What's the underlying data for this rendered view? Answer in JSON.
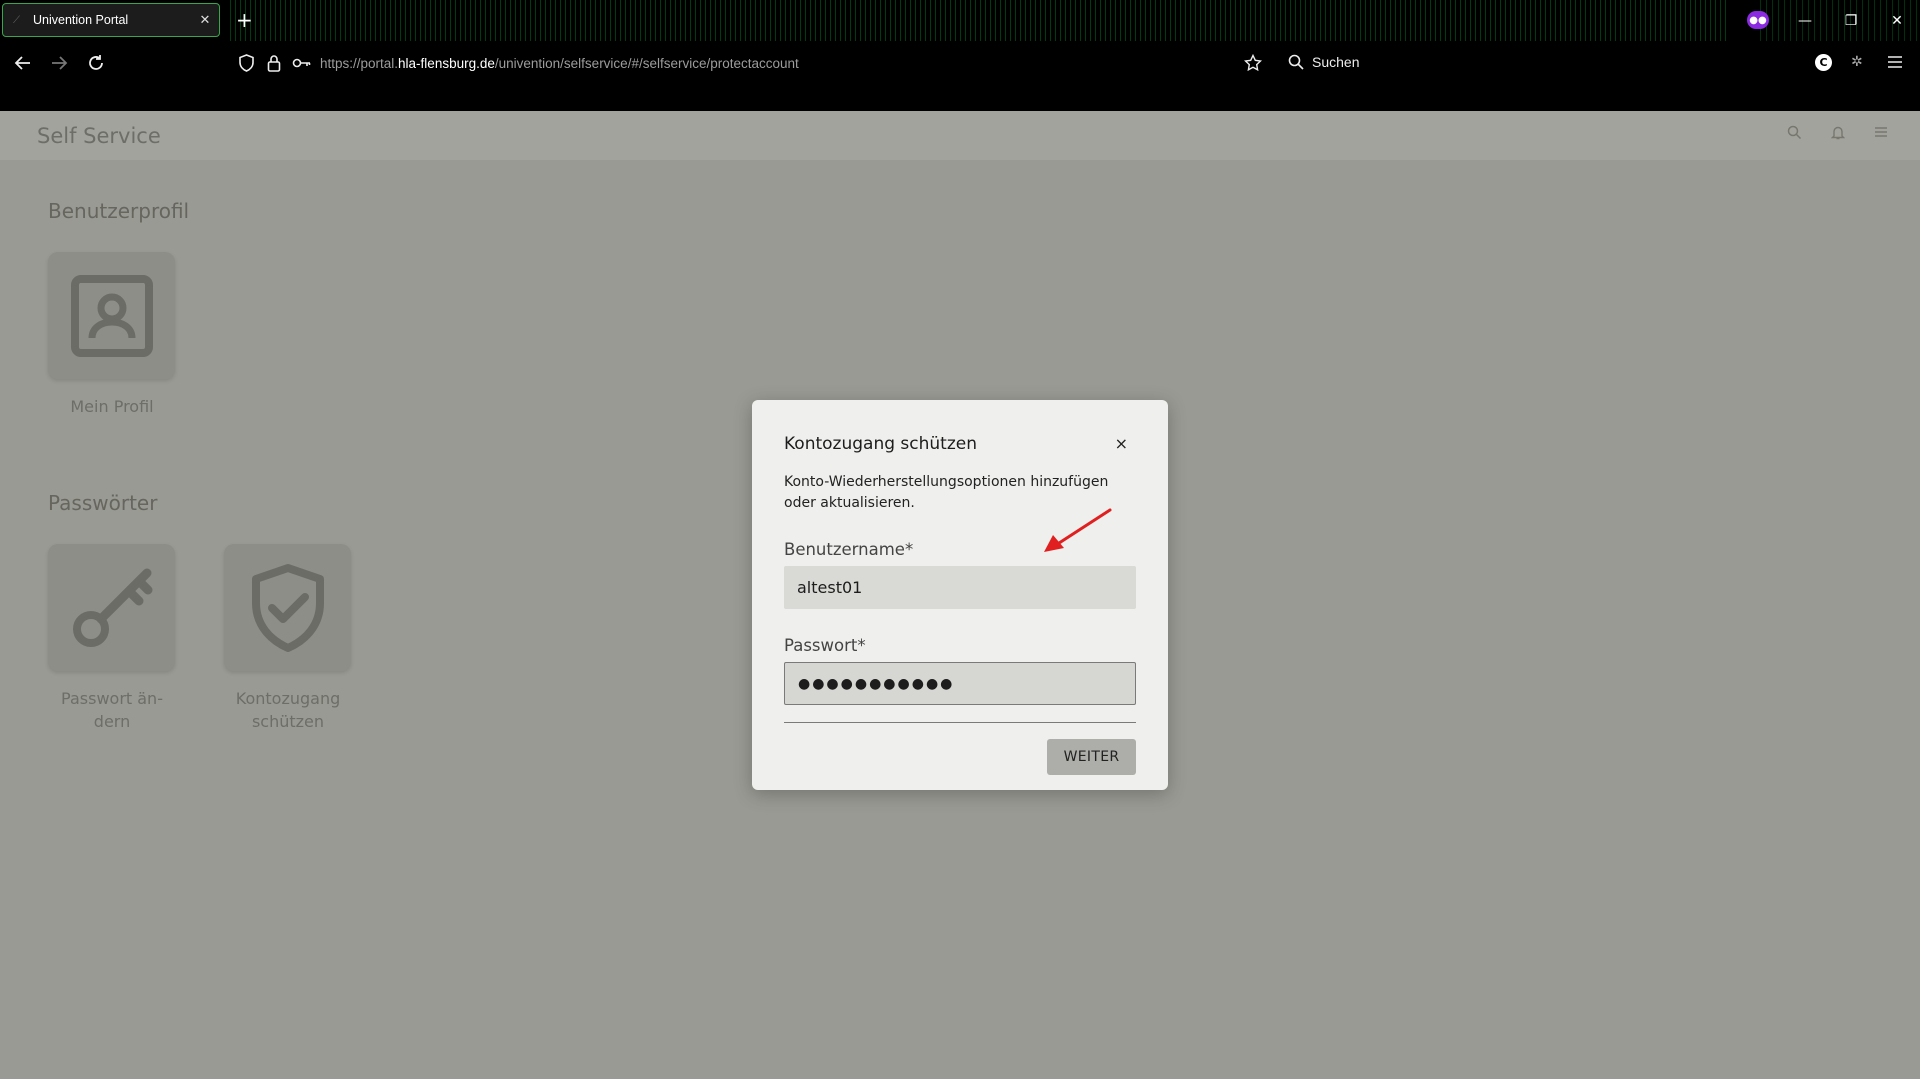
{
  "browser": {
    "tab_title": "Univention Portal",
    "url_prefix": "https://portal.",
    "url_host": "hla-flensburg.de",
    "url_path": "/univention/selfservice/#/selfservice/protectaccount",
    "search_label": "Suchen",
    "extension_letter": "C"
  },
  "app": {
    "title": "Self Service"
  },
  "sections": {
    "profile_title": "Benutzerprofil",
    "profile_tile": "Mein Profil",
    "passwords_title": "Passwörter",
    "password_tile_line1": "Passwort än-",
    "password_tile_line2": "dern",
    "protect_tile_line1": "Kontozugang",
    "protect_tile_line2": "schützen"
  },
  "dialog": {
    "title": "Kontozugang schützen",
    "close_symbol": "×",
    "description": "Konto-Wiederherstellungsoptionen hinzufügen oder aktualisieren.",
    "username_label": "Benutzername*",
    "username_value": "altest01",
    "password_label": "Passwort*",
    "password_value": "●●●●●●●●●●●",
    "submit_label": "WEITER"
  },
  "colors": {
    "annotation_arrow": "#e02020",
    "tab_border": "#3aa64a"
  }
}
